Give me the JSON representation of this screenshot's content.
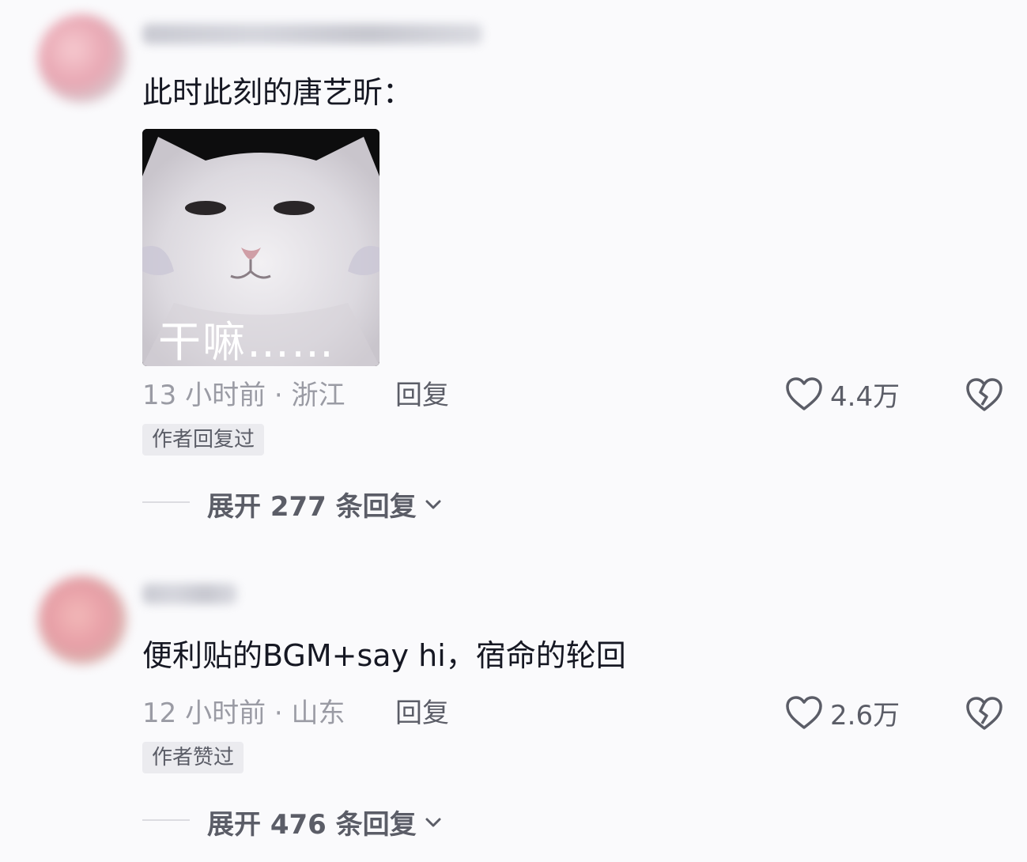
{
  "comments": [
    {
      "text": "此时此刻的唐艺昕：",
      "sticker_caption": "干嘛……",
      "time": "13 小时前 · 浙江",
      "reply_label": "回复",
      "likes": "4.4万",
      "badge": "作者回复过",
      "expand_label": "展开 277 条回复"
    },
    {
      "text": "便利贴的BGM+say hi，宿命的轮回",
      "time": "12 小时前 · 山东",
      "reply_label": "回复",
      "likes": "2.6万",
      "badge": "作者赞过",
      "expand_label": "展开 476 条回复"
    }
  ],
  "icons": {
    "like": "heart-outline-icon",
    "dislike": "broken-heart-icon",
    "expand": "chevron-down-icon"
  },
  "colors": {
    "background": "#fafafc",
    "text_primary": "#161823",
    "text_secondary": "#9a9ba4",
    "text_action": "#5b5d67",
    "badge_bg": "#ebebef"
  }
}
